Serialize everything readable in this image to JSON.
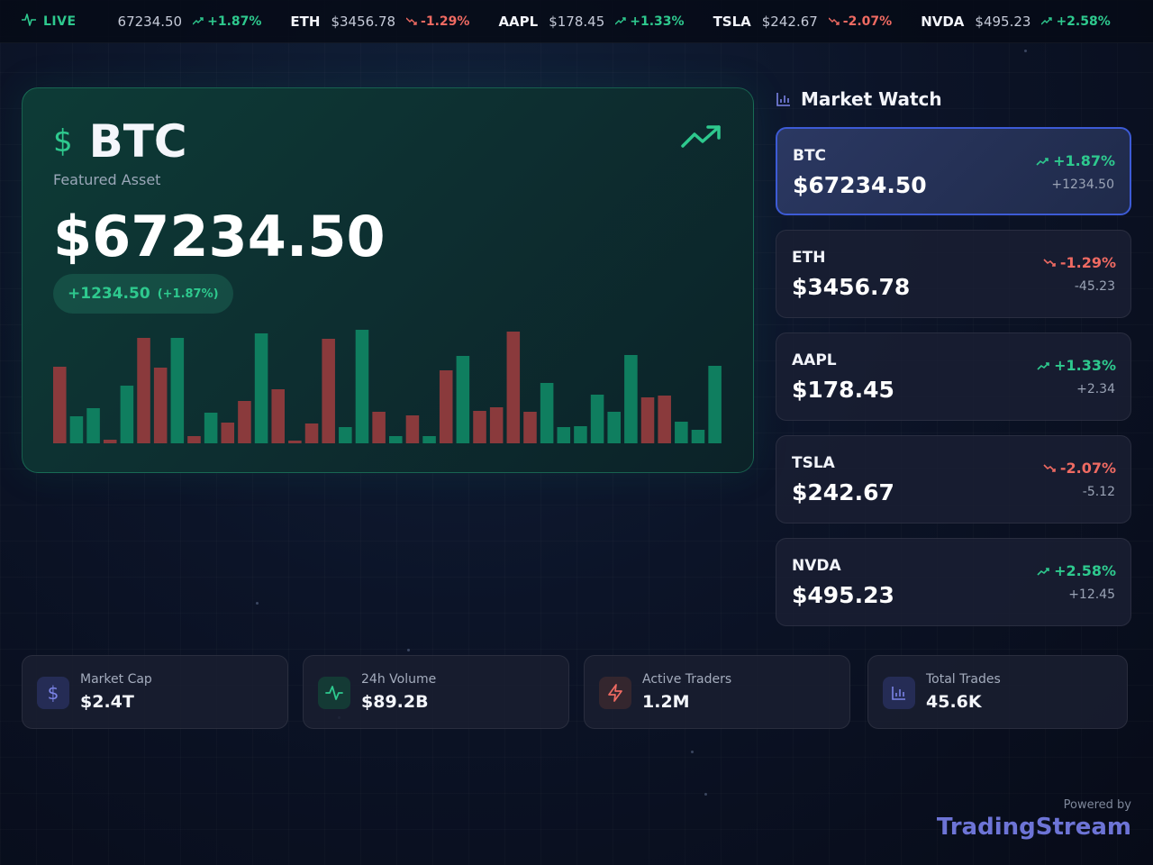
{
  "ticker": {
    "live_label": "LIVE",
    "items": [
      {
        "symbol": "",
        "price": "67234.50",
        "change": "+1.87%",
        "direction": "up"
      },
      {
        "symbol": "ETH",
        "price": "$3456.78",
        "change": "-1.29%",
        "direction": "down"
      },
      {
        "symbol": "AAPL",
        "price": "$178.45",
        "change": "+1.33%",
        "direction": "up"
      },
      {
        "symbol": "TSLA",
        "price": "$242.67",
        "change": "-2.07%",
        "direction": "down"
      },
      {
        "symbol": "NVDA",
        "price": "$495.23",
        "change": "+2.58%",
        "direction": "up"
      }
    ]
  },
  "featured": {
    "icon": "dollar-icon",
    "symbol": "BTC",
    "subtitle": "Featured Asset",
    "price": "$67234.50",
    "change_abs": "+1234.50",
    "change_pct": "(+1.87%)",
    "trend_icon": "trending-up-icon"
  },
  "chart_data": {
    "type": "bar",
    "values": [
      85,
      30,
      39,
      4,
      64,
      117,
      84,
      117,
      8,
      34,
      23,
      47,
      122,
      60,
      3,
      22,
      116,
      18,
      126,
      35,
      8,
      31,
      8,
      81,
      97,
      36,
      40,
      124,
      35,
      67,
      18,
      19,
      54,
      35,
      98,
      51,
      53,
      24,
      15,
      86
    ],
    "directions": [
      "down",
      "up",
      "up",
      "down",
      "up",
      "down",
      "down",
      "up",
      "down",
      "up",
      "down",
      "down",
      "up",
      "down",
      "down",
      "down",
      "down",
      "up",
      "up",
      "down",
      "up",
      "down",
      "up",
      "down",
      "up",
      "down",
      "down",
      "down",
      "down",
      "up",
      "up",
      "up",
      "up",
      "up",
      "up",
      "down",
      "down",
      "up",
      "up",
      "up"
    ],
    "colors": {
      "up": "#0f7e5f",
      "down": "#8a3a3c"
    }
  },
  "market_watch": {
    "title": "Market Watch",
    "items": [
      {
        "symbol": "BTC",
        "price": "$67234.50",
        "change_pct": "+1.87%",
        "change_abs": "+1234.50",
        "direction": "up",
        "active": true
      },
      {
        "symbol": "ETH",
        "price": "$3456.78",
        "change_pct": "-1.29%",
        "change_abs": "-45.23",
        "direction": "down",
        "active": false
      },
      {
        "symbol": "AAPL",
        "price": "$178.45",
        "change_pct": "+1.33%",
        "change_abs": "+2.34",
        "direction": "up",
        "active": false
      },
      {
        "symbol": "TSLA",
        "price": "$242.67",
        "change_pct": "-2.07%",
        "change_abs": "-5.12",
        "direction": "down",
        "active": false
      },
      {
        "symbol": "NVDA",
        "price": "$495.23",
        "change_pct": "+2.58%",
        "change_abs": "+12.45",
        "direction": "up",
        "active": false
      }
    ]
  },
  "stats": [
    {
      "label": "Market Cap",
      "value": "$2.4T",
      "icon": "dollar-icon",
      "color": "#7b83e6",
      "bg": "#252c55"
    },
    {
      "label": "24h Volume",
      "value": "$89.2B",
      "icon": "activity-icon",
      "color": "#2ec98e",
      "bg": "#143a35"
    },
    {
      "label": "Active Traders",
      "value": "1.2M",
      "icon": "zap-icon",
      "color": "#ef6a62",
      "bg": "#34262e"
    },
    {
      "label": "Total Trades",
      "value": "45.6K",
      "icon": "bar-chart-icon",
      "color": "#7b83e6",
      "bg": "#252c55"
    }
  ],
  "footer": {
    "powered_label": "Powered by",
    "brand": "TradingStream"
  },
  "colors": {
    "up": "#2ec98e",
    "down": "#ef6a62",
    "accent": "#6d74d6"
  }
}
